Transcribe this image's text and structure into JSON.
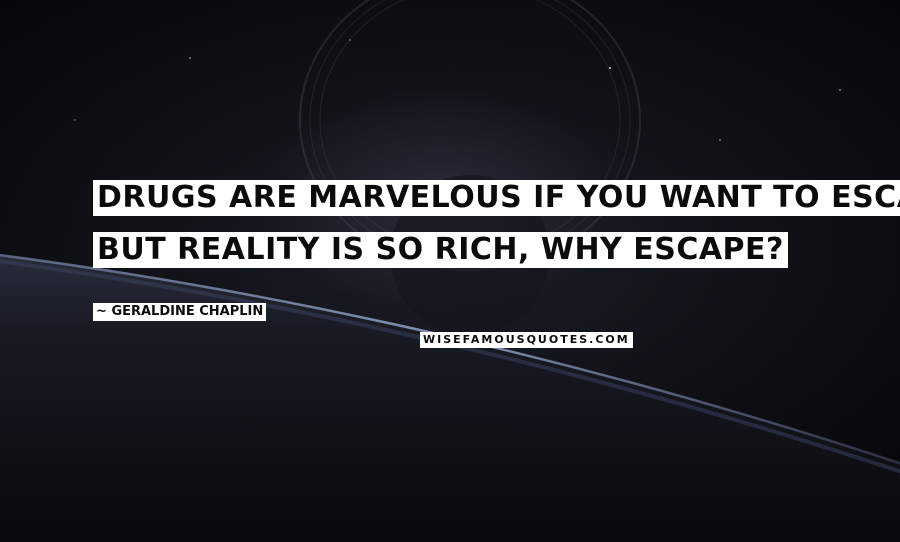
{
  "quote": {
    "lines": [
      "DRUGS ARE MARVELOUS IF YOU WANT TO ESCAPE,",
      "BUT REALITY IS SO RICH, WHY ESCAPE?"
    ]
  },
  "author": {
    "dash": "~",
    "name": "GERALDINE CHAPLIN"
  },
  "watermark": {
    "text": "WISEFAMOUSQUOTES.COM"
  }
}
